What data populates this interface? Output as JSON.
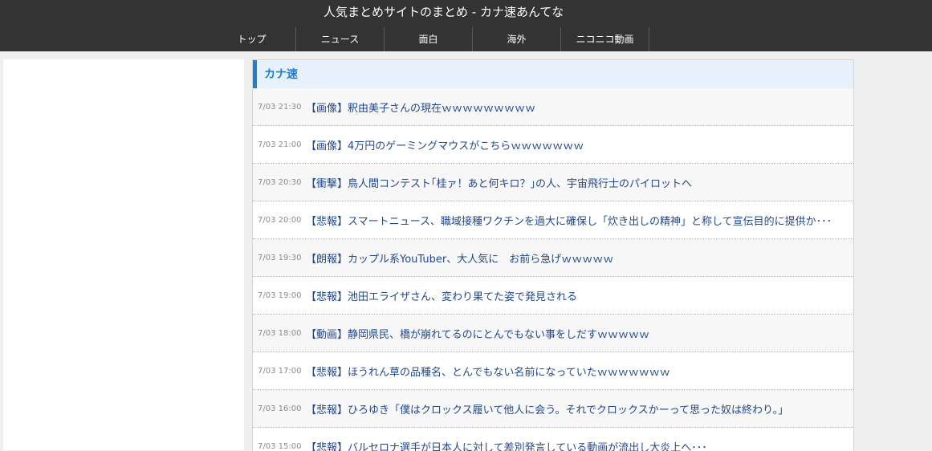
{
  "site": {
    "title": "人気まとめサイトのまとめ - カナ速あんてな"
  },
  "nav": [
    {
      "label": "トップ"
    },
    {
      "label": "ニュース"
    },
    {
      "label": "面白"
    },
    {
      "label": "海外"
    },
    {
      "label": "ニコニコ動画"
    }
  ],
  "feed": {
    "title": "カナ速",
    "articles": [
      {
        "time": "7/03 21:30",
        "title": "【画像】釈由美子さんの現在ｗｗｗｗｗｗｗｗｗ"
      },
      {
        "time": "7/03 21:00",
        "title": "【画像】4万円のゲーミングマウスがこちらｗｗｗｗｗｗｗ"
      },
      {
        "time": "7/03 20:30",
        "title": "【衝撃】鳥人間コンテスト｢桂ァ！あと何キロ？｣の人、宇宙飛行士のパイロットへ"
      },
      {
        "time": "7/03 20:00",
        "title": "【悲報】スマートニュース、職域接種ワクチンを過大に確保し「炊き出しの精神」と称して宣伝目的に提供か･･･"
      },
      {
        "time": "7/03 19:30",
        "title": "【朗報】カップル系YouTuber、大人気に　お前ら急げｗｗｗｗｗ"
      },
      {
        "time": "7/03 19:00",
        "title": "【悲報】池田エライザさん、変わり果てた姿で発見される"
      },
      {
        "time": "7/03 18:00",
        "title": "【動画】静岡県民、橋が崩れてるのにとんでもない事をしだすｗｗｗｗｗ"
      },
      {
        "time": "7/03 17:00",
        "title": "【悲報】ほうれん草の品種名、とんでもない名前になっていたｗｗｗｗｗｗｗ"
      },
      {
        "time": "7/03 16:00",
        "title": "【悲報】ひろゆき「僕はクロックス履いて他人に会う。それでクロックスかーって思った奴は終わり。」"
      },
      {
        "time": "7/03 15:00",
        "title": "【悲報】バルセロナ選手が日本人に対して差別発言している動画が流出し大炎上へ･･･"
      }
    ]
  }
}
